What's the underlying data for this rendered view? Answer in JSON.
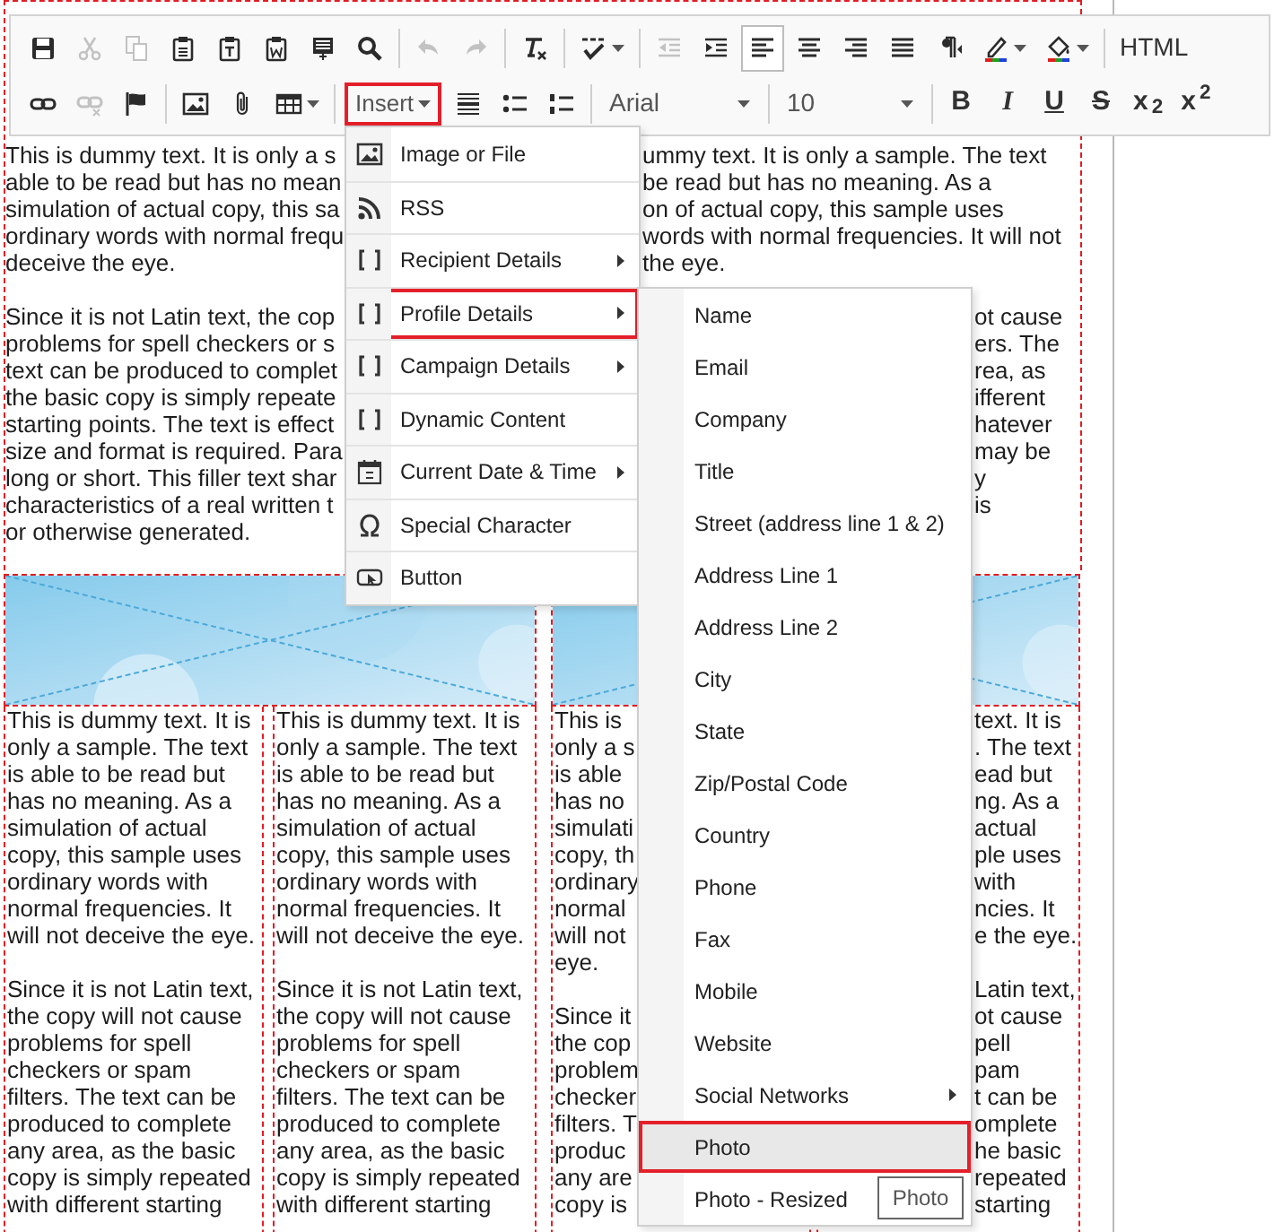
{
  "toolbar": {
    "rows": [
      [
        [
          {
            "kind": "icon",
            "disabled": false,
            "active": false
          },
          {
            "kind": "icon",
            "disabled": true,
            "active": false
          },
          {
            "kind": "icon",
            "disabled": true,
            "active": false
          },
          {
            "kind": "icon",
            "disabled": false,
            "active": false
          },
          {
            "kind": "icon",
            "disabled": false,
            "active": false
          },
          {
            "kind": "icon",
            "disabled": false,
            "active": false
          },
          {
            "kind": "icon",
            "disabled": false,
            "active": false
          },
          {
            "kind": "icon",
            "disabled": false,
            "active": false
          }
        ],
        [
          {
            "kind": "icon",
            "disabled": true,
            "active": false
          },
          {
            "kind": "icon",
            "disabled": true,
            "active": false
          }
        ],
        [
          {
            "kind": "icon",
            "disabled": false,
            "active": false
          }
        ],
        [
          {
            "kind": "icon",
            "disabled": false,
            "active": false,
            "caret": true
          }
        ],
        [
          {
            "kind": "icon",
            "disabled": true,
            "active": false
          },
          {
            "kind": "icon",
            "disabled": false,
            "active": false
          },
          {
            "kind": "icon",
            "disabled": false,
            "active": true
          },
          {
            "kind": "icon",
            "disabled": false,
            "active": false
          },
          {
            "kind": "icon",
            "disabled": false,
            "active": false
          },
          {
            "kind": "icon",
            "disabled": false,
            "active": false
          },
          {
            "kind": "icon",
            "disabled": false,
            "active": false
          },
          {
            "kind": "icon",
            "disabled": false,
            "active": false,
            "caret": true
          },
          {
            "kind": "icon",
            "disabled": false,
            "active": false,
            "caret": true
          }
        ],
        [
          {
            "kind": "label",
            "label": "HTML"
          }
        ]
      ],
      [
        [
          {
            "kind": "icon",
            "disabled": false,
            "active": false
          },
          {
            "kind": "icon",
            "disabled": true,
            "active": false
          },
          {
            "kind": "icon",
            "disabled": false,
            "active": false
          }
        ],
        [
          {
            "kind": "icon",
            "disabled": false,
            "active": false
          },
          {
            "kind": "icon",
            "disabled": false,
            "active": false
          },
          {
            "kind": "icon",
            "disabled": false,
            "active": false,
            "caret": true
          }
        ],
        [
          {
            "kind": "menu",
            "label": "Insert",
            "highlighted": true
          },
          {
            "kind": "icon",
            "disabled": false,
            "active": false
          },
          {
            "kind": "icon",
            "disabled": false,
            "active": false
          },
          {
            "kind": "icon",
            "disabled": false,
            "active": false
          }
        ],
        [
          {
            "kind": "select",
            "value": "Arial"
          }
        ],
        [
          {
            "kind": "select",
            "value": "10"
          }
        ],
        [
          {
            "kind": "label",
            "label": "B"
          },
          {
            "kind": "label",
            "label": "I"
          },
          {
            "kind": "label",
            "label": "U"
          },
          {
            "kind": "label",
            "label": "S"
          },
          {
            "kind": "label",
            "label": "x$_{2}$"
          },
          {
            "kind": "label",
            "label": "x$^{2}$"
          }
        ]
      ]
    ]
  },
  "document": {
    "top_block": {
      "columns": [
        {
          "kind": "partial",
          "lines": [
            {
              "kind": "left",
              "text": "This is dummy text. It is only a s"
            },
            {
              "kind": "left",
              "text": "able to be read but has no mean"
            },
            {
              "kind": "left",
              "text": "simulation of actual copy, this sa"
            },
            {
              "kind": "left",
              "text": "ordinary words with normal frequ"
            },
            {
              "kind": "left",
              "text": "deceive the eye."
            },
            {
              "kind": "blank"
            },
            {
              "kind": "left",
              "text": "Since it is not Latin text, the cop"
            },
            {
              "kind": "left",
              "text": "problems for spell checkers or s"
            },
            {
              "kind": "left",
              "text": "text can be produced to complet"
            },
            {
              "kind": "left",
              "text": "the basic copy is simply repeate"
            },
            {
              "kind": "left",
              "text": "starting points. The text is effect"
            },
            {
              "kind": "left",
              "text": "size and format is required. Para"
            },
            {
              "kind": "left",
              "text": "long or short. This filler text shar"
            },
            {
              "kind": "left",
              "text": "characteristics of a real written t"
            },
            {
              "kind": "left",
              "text": "or otherwise generated."
            }
          ]
        },
        {
          "kind": "partial",
          "lines": [
            {
              "kind": "right",
              "text": "ummy text. It is only a sample. The text"
            },
            {
              "kind": "right",
              "text": "be read but has no meaning. As a"
            },
            {
              "kind": "right",
              "text": "on of actual copy, this sample uses"
            },
            {
              "kind": "right",
              "text": "words with normal frequencies. It will not"
            },
            {
              "kind": "right",
              "text": "the eye."
            },
            {
              "kind": "blank"
            },
            {
              "kind": "right",
              "text": "ot cause"
            },
            {
              "kind": "right",
              "text": "ers. The"
            },
            {
              "kind": "right",
              "text": "rea, as"
            },
            {
              "kind": "right",
              "text": "ifferent"
            },
            {
              "kind": "right",
              "text": "hatever"
            },
            {
              "kind": "right",
              "text": "may be"
            },
            {
              "kind": "right",
              "text": "y"
            },
            {
              "kind": "right",
              "text": "is"
            }
          ]
        }
      ]
    },
    "halves": [
      {
        "banner": {
          "kind": "picture"
        },
        "columns": [
          {
            "kind": "full",
            "paragraphs": [
              [
                "This is dummy text. It is",
                "only a sample. The text",
                "is able to be read but",
                "has no meaning. As a",
                "simulation of actual",
                "copy, this sample uses",
                "ordinary words with",
                "normal frequencies. It",
                "will not deceive the eye."
              ],
              [
                "Since it is not Latin text,",
                "the copy will not cause",
                "problems for spell",
                "checkers or spam",
                "filters. The text can be",
                "produced to complete",
                "any area, as the basic",
                "copy is simply repeated",
                "with different starting"
              ]
            ]
          },
          {
            "kind": "full",
            "paragraphs": [
              [
                "This is dummy text. It is",
                "only a sample. The text",
                "is able to be read but",
                "has no meaning. As a",
                "simulation of actual",
                "copy, this sample uses",
                "ordinary words with",
                "normal frequencies. It",
                "will not deceive the eye."
              ],
              [
                "Since it is not Latin text,",
                "the copy will not cause",
                "problems for spell",
                "checkers or spam",
                "filters. The text can be",
                "produced to complete",
                "any area, as the basic",
                "copy is simply repeated",
                "with different starting"
              ]
            ]
          }
        ]
      },
      {
        "banner": {
          "kind": "picture"
        },
        "columns": [
          {
            "kind": "partial",
            "lines": [
              {
                "kind": "left",
                "text": "This is"
              },
              {
                "kind": "left",
                "text": "only a s"
              },
              {
                "kind": "left",
                "text": "is able"
              },
              {
                "kind": "left",
                "text": "has no"
              },
              {
                "kind": "left",
                "text": "simulati"
              },
              {
                "kind": "left",
                "text": "copy, th"
              },
              {
                "kind": "left",
                "text": "ordinary"
              },
              {
                "kind": "left",
                "text": "normal"
              },
              {
                "kind": "left",
                "text": "will not"
              },
              {
                "kind": "left",
                "text": "eye."
              },
              {
                "kind": "blank"
              },
              {
                "kind": "left",
                "text": "Since it"
              },
              {
                "kind": "left",
                "text": "the cop"
              },
              {
                "kind": "left",
                "text": "problem"
              },
              {
                "kind": "left",
                "text": "checker"
              },
              {
                "kind": "left",
                "text": "filters. T"
              },
              {
                "kind": "left",
                "text": "produc"
              },
              {
                "kind": "left",
                "text": "any are"
              },
              {
                "kind": "left",
                "text": "copy is"
              }
            ]
          },
          {
            "kind": "partial",
            "lines": [
              {
                "kind": "right",
                "text": "text. It is"
              },
              {
                "kind": "right",
                "text": ". The text"
              },
              {
                "kind": "right",
                "text": "ead but"
              },
              {
                "kind": "right",
                "text": "ng. As a"
              },
              {
                "kind": "right",
                "text": "actual"
              },
              {
                "kind": "right",
                "text": "ple uses"
              },
              {
                "kind": "right",
                "text": "with"
              },
              {
                "kind": "right",
                "text": "ncies. It"
              },
              {
                "kind": "right",
                "text": "e the eye."
              },
              {
                "kind": "blank"
              },
              {
                "kind": "right",
                "text": "Latin text,"
              },
              {
                "kind": "right",
                "text": "ot cause"
              },
              {
                "kind": "right",
                "text": "pell"
              },
              {
                "kind": "right",
                "text": "pam"
              },
              {
                "kind": "right",
                "text": "t can be"
              },
              {
                "kind": "right",
                "text": "omplete"
              },
              {
                "kind": "right",
                "text": "he basic"
              },
              {
                "kind": "right",
                "text": "repeated"
              },
              {
                "kind": "right",
                "text": "starting"
              }
            ]
          }
        ]
      }
    ]
  },
  "insert_menu": {
    "items": [
      {
        "label": "Image or File",
        "has_submenu": false,
        "highlighted": false
      },
      {
        "label": "RSS",
        "has_submenu": false,
        "highlighted": false
      },
      {
        "label": "Recipient Details",
        "has_submenu": true,
        "highlighted": false
      },
      {
        "label": "Profile Details",
        "has_submenu": true,
        "highlighted": true
      },
      {
        "label": "Campaign Details",
        "has_submenu": true,
        "highlighted": false
      },
      {
        "label": "Dynamic Content",
        "has_submenu": false,
        "highlighted": false
      },
      {
        "label": "Current Date & Time",
        "has_submenu": true,
        "highlighted": false
      },
      {
        "label": "Special Character",
        "has_submenu": false,
        "highlighted": false
      },
      {
        "label": "Button",
        "has_submenu": false,
        "highlighted": false
      }
    ]
  },
  "profile_submenu": {
    "items": [
      {
        "label": "Name",
        "has_submenu": false,
        "highlighted": false,
        "selected": false
      },
      {
        "label": "Email",
        "has_submenu": false,
        "highlighted": false,
        "selected": false
      },
      {
        "label": "Company",
        "has_submenu": false,
        "highlighted": false,
        "selected": false
      },
      {
        "label": "Title",
        "has_submenu": false,
        "highlighted": false,
        "selected": false
      },
      {
        "label": "Street (address line 1 & 2)",
        "has_submenu": false,
        "highlighted": false,
        "selected": false
      },
      {
        "label": "Address Line 1",
        "has_submenu": false,
        "highlighted": false,
        "selected": false
      },
      {
        "label": "Address Line 2",
        "has_submenu": false,
        "highlighted": false,
        "selected": false
      },
      {
        "label": "City",
        "has_submenu": false,
        "highlighted": false,
        "selected": false
      },
      {
        "label": "State",
        "has_submenu": false,
        "highlighted": false,
        "selected": false
      },
      {
        "label": "Zip/Postal Code",
        "has_submenu": false,
        "highlighted": false,
        "selected": false
      },
      {
        "label": "Country",
        "has_submenu": false,
        "highlighted": false,
        "selected": false
      },
      {
        "label": "Phone",
        "has_submenu": false,
        "highlighted": false,
        "selected": false
      },
      {
        "label": "Fax",
        "has_submenu": false,
        "highlighted": false,
        "selected": false
      },
      {
        "label": "Mobile",
        "has_submenu": false,
        "highlighted": false,
        "selected": false
      },
      {
        "label": "Website",
        "has_submenu": false,
        "highlighted": false,
        "selected": false
      },
      {
        "label": "Social Networks",
        "has_submenu": true,
        "highlighted": false,
        "selected": false
      },
      {
        "label": "Photo",
        "has_submenu": false,
        "highlighted": true,
        "selected": true
      },
      {
        "label": "Photo - Resized",
        "highlighted": false,
        "selected": false
      }
    ],
    "tooltip": "Photo"
  }
}
